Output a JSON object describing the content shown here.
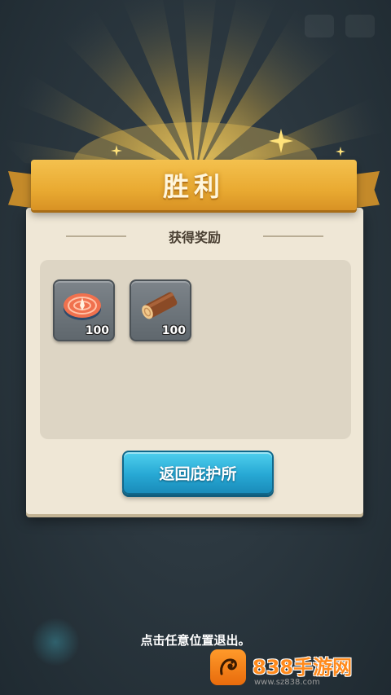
{
  "banner": {
    "title": "胜利"
  },
  "panel": {
    "subtitle": "获得奖励",
    "rewards": [
      {
        "icon": "salmon-steak-icon",
        "count": "100"
      },
      {
        "icon": "wood-log-icon",
        "count": "100"
      }
    ],
    "button_label": "返回庇护所"
  },
  "hint": "点击任意位置退出。",
  "watermark": {
    "brand": "838手游网",
    "url": "www.sz838.com"
  },
  "colors": {
    "banner": "#e9aa32",
    "panel": "#efe7d6",
    "button": "#27a8d4"
  }
}
